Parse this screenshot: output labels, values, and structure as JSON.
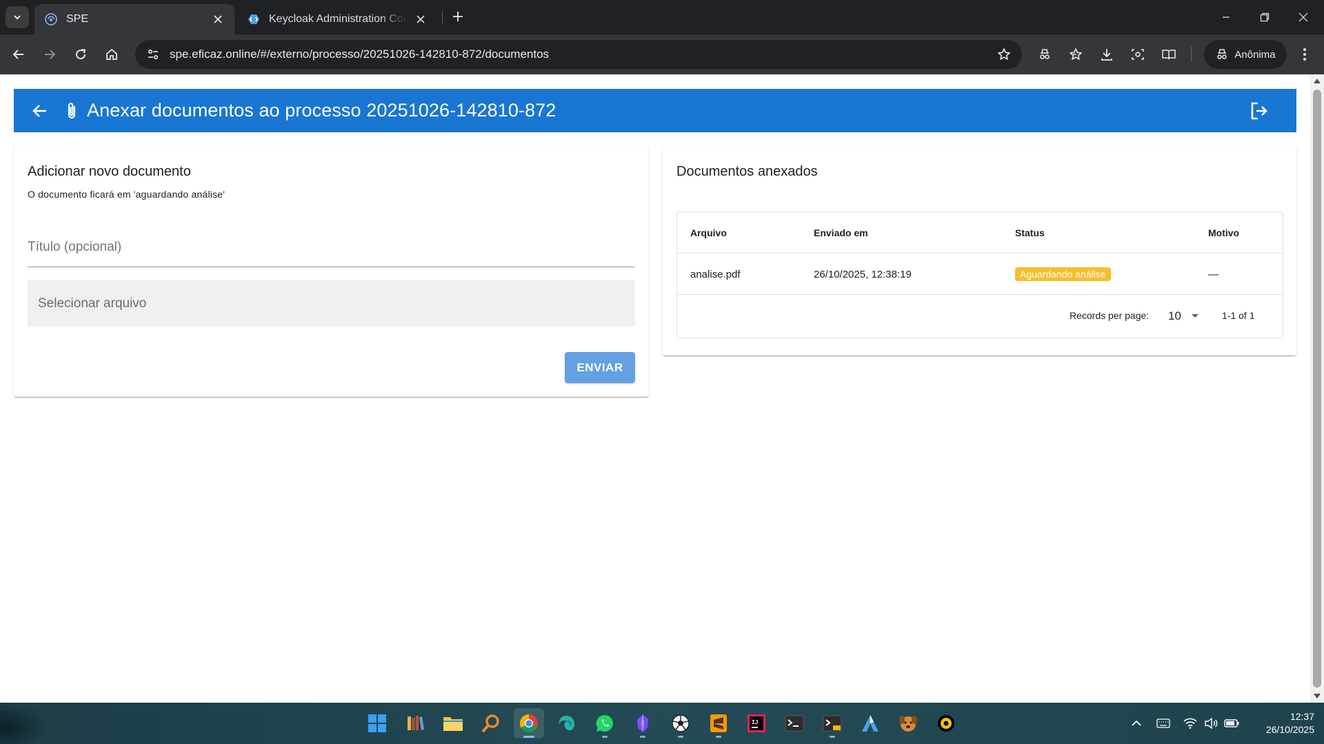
{
  "browser": {
    "tabs": [
      {
        "title": "SPE",
        "active": true
      },
      {
        "title": "Keycloak Administration Console",
        "active": false
      }
    ],
    "url": "spe.eficaz.online/#/externo/processo/20251026-142810-872/documentos",
    "profile_label": "Anônima"
  },
  "header": {
    "title": "Anexar documentos ao processo 20251026-142810-872",
    "color": "#1976d2"
  },
  "upload_card": {
    "title": "Adicionar novo documento",
    "subtitle": "O documento ficará em 'aguardando análise'",
    "title_placeholder": "Título (opcional)",
    "file_placeholder": "Selecionar arquivo",
    "submit_label": "ENVIAR"
  },
  "documents_card": {
    "title": "Documentos anexados",
    "columns": [
      "Arquivo",
      "Enviado em",
      "Status",
      "Motivo"
    ],
    "rows": [
      {
        "arquivo": "analise.pdf",
        "enviado_em": "26/10/2025, 12:38:19",
        "status": "Aguardando análise",
        "motivo": "—"
      }
    ],
    "status_color": "#f9be2c",
    "records_per_page_label": "Records per page:",
    "records_per_page_value": "10",
    "range_text": "1-1 of 1"
  },
  "taskbar": {
    "apps": [
      "windows-start",
      "library",
      "file-explorer",
      "search-tool",
      "chrome",
      "edge-dev",
      "whatsapp",
      "obsidian",
      "soccer-app",
      "sublime-text",
      "intellij",
      "terminal",
      "terminal-canary",
      "arc-app",
      "dog-app",
      "settings-app"
    ],
    "time": "12:37",
    "date": "26/10/2025"
  }
}
